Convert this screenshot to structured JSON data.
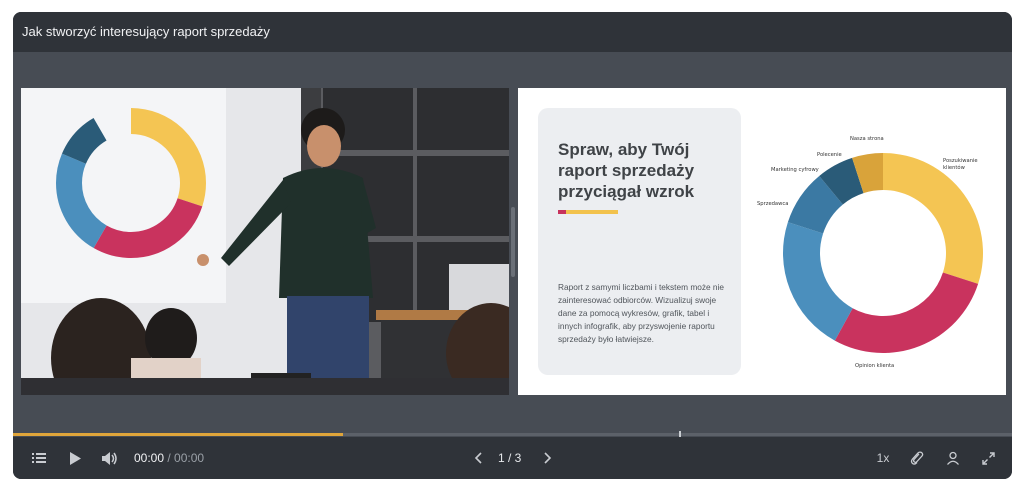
{
  "window": {
    "title": "Jak stworzyć interesujący raport sprzedaży"
  },
  "slide": {
    "heading": "Spraw, aby Twój raport sprzedaży przyciągał wzrok",
    "body": "Raport z samymi liczbami i tekstem może nie zainteresować odbiorców. Wizualizuj swoje dane za pomocą wykresów, grafik, tabel i innych infografik, aby przyswojenie raportu sprzedaży było łatwiejsze.",
    "accent_colors": [
      "#c7325c",
      "#f2c24d"
    ]
  },
  "chart_data": {
    "type": "pie",
    "title": "",
    "categories": [
      "Poszukiwanie klientów",
      "Opinion klienta",
      "Sprzedawca",
      "Marketing cyfrowy",
      "Polecenie",
      "Nasza strona"
    ],
    "values": [
      30,
      28,
      22,
      9,
      6,
      5
    ],
    "colors": [
      "#f4c553",
      "#c9335e",
      "#4b8fbd",
      "#3b79a3",
      "#2a5b78",
      "#d9a33a"
    ],
    "labels": {
      "poszukiwanie": "Poszukiwanie klientów",
      "opinion": "Opinion klienta",
      "sprzedawca": "Sprzedawca",
      "marketing": "Marketing cyfrowy",
      "polecenie": "Polecenie",
      "strona": "Nasza strona"
    }
  },
  "player": {
    "progress_percent": 33,
    "time_current": "00:00",
    "time_separator": " / ",
    "time_total": "00:00",
    "page": "1 / 3",
    "speed": "1x",
    "accent_color": "#e0a53a"
  },
  "icons": {
    "menu": "list-icon",
    "play": "play-icon",
    "volume": "volume-icon",
    "prev": "chevron-left-icon",
    "next": "chevron-right-icon",
    "attach": "paperclip-icon",
    "user": "user-icon",
    "fullscreen": "fullscreen-icon"
  }
}
